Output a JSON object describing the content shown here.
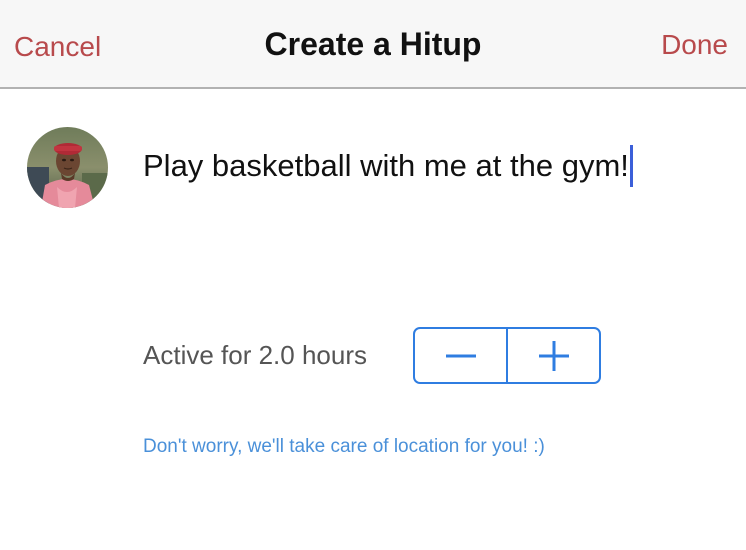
{
  "navbar": {
    "cancel_label": "Cancel",
    "title": "Create a Hitup",
    "done_label": "Done"
  },
  "composer": {
    "message": "Play basketball with me at the gym!"
  },
  "duration": {
    "label": "Active for 2.0 hours",
    "hours": 2.0,
    "decrement_icon": "minus-icon",
    "increment_icon": "plus-icon"
  },
  "location_note": "Don't worry, we'll take care of location for you! :)",
  "colors": {
    "nav_action": "#b84a4c",
    "stepper_accent": "#2f7de1",
    "link_blue": "#4a90d9",
    "caret": "#3b5fd9"
  }
}
